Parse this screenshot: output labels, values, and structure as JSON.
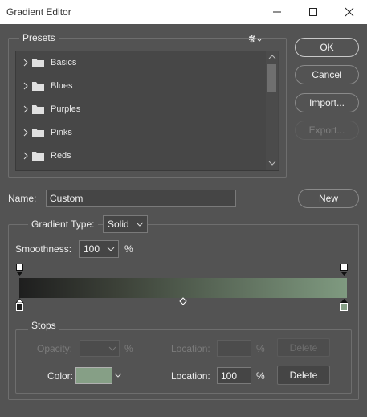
{
  "window": {
    "title": "Gradient Editor"
  },
  "presets": {
    "label": "Presets",
    "settings_icon": "gear-icon",
    "items": [
      {
        "label": "Basics"
      },
      {
        "label": "Blues"
      },
      {
        "label": "Purples"
      },
      {
        "label": "Pinks"
      },
      {
        "label": "Reds"
      }
    ]
  },
  "buttons": {
    "ok": "OK",
    "cancel": "Cancel",
    "import": "Import...",
    "export": "Export...",
    "new": "New"
  },
  "name_field": {
    "label": "Name:",
    "value": "Custom"
  },
  "gradient": {
    "type_label": "Gradient Type:",
    "type_value": "Solid",
    "smoothness_label": "Smoothness:",
    "smoothness_value": "100",
    "smoothness_unit": "%",
    "colors": {
      "start": "#1e1e1e",
      "end": "#7f9a80"
    }
  },
  "stops": {
    "label": "Stops",
    "opacity_label": "Opacity:",
    "opacity_unit": "%",
    "opacity_location_label": "Location:",
    "opacity_location_unit": "%",
    "opacity_delete": "Delete",
    "color_label": "Color:",
    "color_swatch": "#869f86",
    "color_location_label": "Location:",
    "color_location_value": "100",
    "color_location_unit": "%",
    "color_delete": "Delete"
  }
}
